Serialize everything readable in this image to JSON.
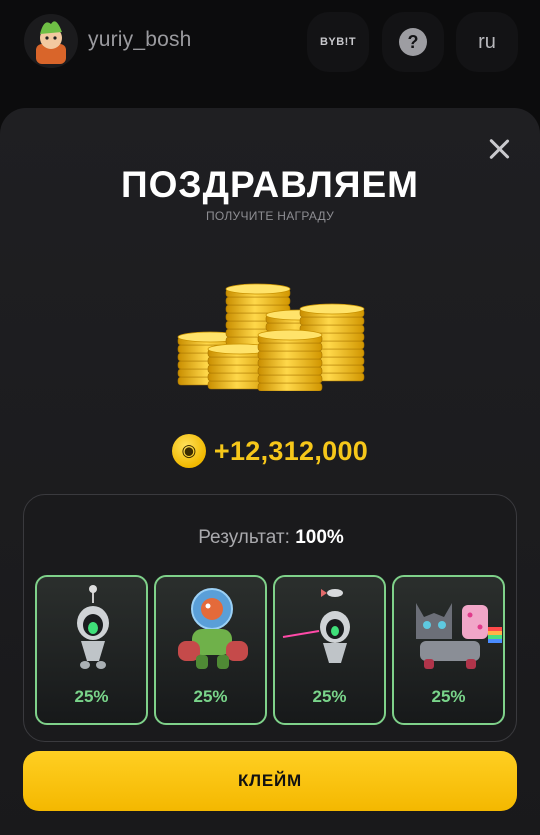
{
  "header": {
    "username": "yuriy_bosh",
    "bybit_label": "BYB!T",
    "help_glyph": "?",
    "language": "ru",
    "icons": [
      "avatar",
      "bybit-logo",
      "help-icon"
    ]
  },
  "modal": {
    "title": "ПОЗДРАВЛЯЕМ",
    "subtitle": "ПОЛУЧИТЕ НАГРАДУ",
    "reward_amount": "+12,312,000",
    "result_label": "Результат:",
    "result_value": "100%",
    "cards": [
      {
        "name": "robot-astronaut",
        "percent": "25%"
      },
      {
        "name": "fish-mech-warrior",
        "percent": "25%"
      },
      {
        "name": "robot-astronaut-laser",
        "percent": "25%"
      },
      {
        "name": "nyan-cat-robot",
        "percent": "25%"
      }
    ],
    "claim_label": "КЛЕЙМ"
  },
  "colors": {
    "accent_yellow": "#f6c71a",
    "card_border": "#7fd18a",
    "percent_green": "#79d48a",
    "background": "#0c0c0d"
  }
}
